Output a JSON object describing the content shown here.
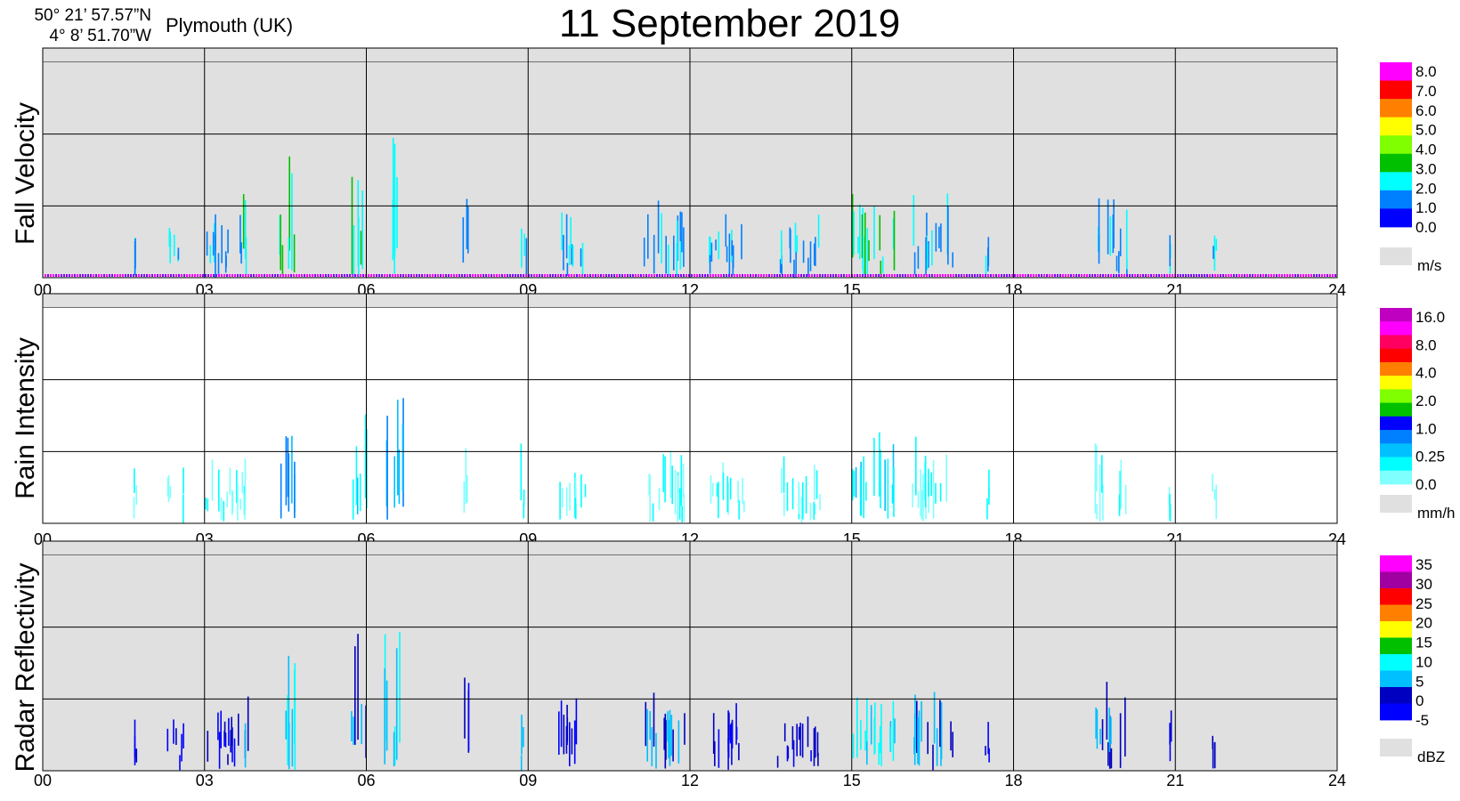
{
  "header": {
    "lat": "50° 21’ 57.57”N",
    "lon": "4°  8’ 51.70”W",
    "location": "Plymouth (UK)",
    "title": "11 September  2019"
  },
  "chart_data": [
    {
      "type": "heatmap",
      "ylabel": "Fall Velocity",
      "background": "#e0e0e0",
      "x_ticks": [
        "00",
        "03",
        "06",
        "09",
        "12",
        "15",
        "18",
        "21",
        "24"
      ],
      "xlim": [
        0,
        24
      ],
      "colorbar": {
        "labels": [
          "8.0",
          "7.0",
          "6.0",
          "5.0",
          "4.0",
          "3.0",
          "2.0",
          "1.0",
          "0.0"
        ],
        "colors": [
          "#ff00ff",
          "#ff0000",
          "#ff8000",
          "#ffff00",
          "#80ff00",
          "#00c000",
          "#00ffff",
          "#0080ff",
          "#0000ff"
        ],
        "nodata_color": "#e0e0e0",
        "unit": "m/s"
      },
      "events": [
        {
          "t": 1.7,
          "span": 0.05,
          "top": 0.25,
          "level": 1
        },
        {
          "t": 2.45,
          "span": 0.3,
          "top": 0.15,
          "level": 1
        },
        {
          "t": 3.35,
          "span": 0.7,
          "top": 0.2,
          "level": 1
        },
        {
          "t": 3.75,
          "span": 0.1,
          "top": 0.3,
          "level": 2
        },
        {
          "t": 4.55,
          "span": 0.35,
          "top": 0.5,
          "level": 2
        },
        {
          "t": 5.85,
          "span": 0.3,
          "top": 0.5,
          "level": 2
        },
        {
          "t": 6.5,
          "span": 0.35,
          "top": 0.53,
          "level": 2
        },
        {
          "t": 7.85,
          "span": 0.15,
          "top": 0.4,
          "level": 1
        },
        {
          "t": 8.9,
          "span": 0.12,
          "top": 0.28,
          "level": 1
        },
        {
          "t": 9.8,
          "span": 0.5,
          "top": 0.22,
          "level": 1
        },
        {
          "t": 11.5,
          "span": 0.8,
          "top": 0.26,
          "level": 1
        },
        {
          "t": 12.7,
          "span": 0.7,
          "top": 0.2,
          "level": 1
        },
        {
          "t": 14.0,
          "span": 0.8,
          "top": 0.18,
          "level": 1
        },
        {
          "t": 15.4,
          "span": 0.8,
          "top": 0.3,
          "level": 2
        },
        {
          "t": 16.5,
          "span": 0.8,
          "top": 0.28,
          "level": 1
        },
        {
          "t": 17.5,
          "span": 0.1,
          "top": 0.15,
          "level": 1
        },
        {
          "t": 19.8,
          "span": 0.6,
          "top": 0.28,
          "level": 1
        },
        {
          "t": 20.9,
          "span": 0.05,
          "top": 0.15,
          "level": 1
        },
        {
          "t": 21.7,
          "span": 0.1,
          "top": 0.18,
          "level": 1
        }
      ]
    },
    {
      "type": "heatmap",
      "ylabel": "Rain Intensity",
      "background": "#ffffff",
      "x_ticks": [
        "00",
        "03",
        "06",
        "09",
        "12",
        "15",
        "18",
        "21",
        "24"
      ],
      "xlim": [
        0,
        24
      ],
      "colorbar": {
        "labels": [
          "16.0",
          "8.0",
          "4.0",
          "2.0",
          "1.0",
          "0.25",
          "0.0"
        ],
        "colors": [
          "#c000c0",
          "#ff00ff",
          "#ff0060",
          "#ff0000",
          "#ff8000",
          "#ffff00",
          "#80ff00",
          "#00c000",
          "#0000ff",
          "#0080ff",
          "#00c0ff",
          "#00ffff",
          "#80ffff"
        ],
        "nodata_color": "#e0e0e0",
        "unit": "mm/h"
      },
      "events": [
        {
          "t": 1.7,
          "span": 0.05,
          "top": 0.25,
          "level": 0
        },
        {
          "t": 2.45,
          "span": 0.3,
          "top": 0.15,
          "level": 0
        },
        {
          "t": 3.35,
          "span": 0.7,
          "top": 0.2,
          "level": 0
        },
        {
          "t": 3.75,
          "span": 0.1,
          "top": 0.3,
          "level": 0
        },
        {
          "t": 4.55,
          "span": 0.35,
          "top": 0.5,
          "level": 2
        },
        {
          "t": 5.85,
          "span": 0.3,
          "top": 0.5,
          "level": 1
        },
        {
          "t": 6.5,
          "span": 0.35,
          "top": 0.53,
          "level": 2
        },
        {
          "t": 7.85,
          "span": 0.15,
          "top": 0.4,
          "level": 0
        },
        {
          "t": 8.9,
          "span": 0.12,
          "top": 0.28,
          "level": 0
        },
        {
          "t": 9.8,
          "span": 0.5,
          "top": 0.22,
          "level": 0
        },
        {
          "t": 11.5,
          "span": 0.8,
          "top": 0.26,
          "level": 0
        },
        {
          "t": 12.7,
          "span": 0.7,
          "top": 0.2,
          "level": 0
        },
        {
          "t": 14.0,
          "span": 0.8,
          "top": 0.18,
          "level": 0
        },
        {
          "t": 15.4,
          "span": 0.8,
          "top": 0.3,
          "level": 1
        },
        {
          "t": 16.5,
          "span": 0.8,
          "top": 0.28,
          "level": 0
        },
        {
          "t": 17.5,
          "span": 0.1,
          "top": 0.15,
          "level": 0
        },
        {
          "t": 19.8,
          "span": 0.6,
          "top": 0.28,
          "level": 0
        },
        {
          "t": 20.9,
          "span": 0.05,
          "top": 0.15,
          "level": 0
        },
        {
          "t": 21.7,
          "span": 0.1,
          "top": 0.18,
          "level": 0
        }
      ]
    },
    {
      "type": "heatmap",
      "ylabel": "Radar Reflectivity",
      "background": "#e0e0e0",
      "x_ticks": [
        "00",
        "03",
        "06",
        "09",
        "12",
        "15",
        "18",
        "21",
        "24"
      ],
      "xlim": [
        0,
        24
      ],
      "colorbar": {
        "labels": [
          "35",
          "30",
          "25",
          "20",
          "15",
          "10",
          "5",
          "0",
          "-5"
        ],
        "colors": [
          "#ff00ff",
          "#a000a0",
          "#ff0000",
          "#ff8000",
          "#ffff00",
          "#00c000",
          "#00ffff",
          "#00c0ff",
          "#0000c0",
          "#0000ff"
        ],
        "nodata_color": "#e0e0e0",
        "unit": "dBZ"
      },
      "events": [
        {
          "t": 1.7,
          "span": 0.05,
          "top": 0.25,
          "level": 0
        },
        {
          "t": 2.45,
          "span": 0.3,
          "top": 0.15,
          "level": 0
        },
        {
          "t": 3.35,
          "span": 0.7,
          "top": 0.2,
          "level": 0
        },
        {
          "t": 3.75,
          "span": 0.1,
          "top": 0.3,
          "level": 1
        },
        {
          "t": 4.55,
          "span": 0.35,
          "top": 0.5,
          "level": 2
        },
        {
          "t": 5.85,
          "span": 0.3,
          "top": 0.5,
          "level": 1
        },
        {
          "t": 6.5,
          "span": 0.35,
          "top": 0.53,
          "level": 2
        },
        {
          "t": 7.85,
          "span": 0.15,
          "top": 0.4,
          "level": 0
        },
        {
          "t": 8.9,
          "span": 0.12,
          "top": 0.28,
          "level": 1
        },
        {
          "t": 9.8,
          "span": 0.5,
          "top": 0.22,
          "level": 0
        },
        {
          "t": 11.5,
          "span": 0.8,
          "top": 0.26,
          "level": 1
        },
        {
          "t": 12.7,
          "span": 0.7,
          "top": 0.2,
          "level": 0
        },
        {
          "t": 14.0,
          "span": 0.8,
          "top": 0.18,
          "level": 0
        },
        {
          "t": 15.4,
          "span": 0.8,
          "top": 0.3,
          "level": 2
        },
        {
          "t": 16.5,
          "span": 0.8,
          "top": 0.28,
          "level": 1
        },
        {
          "t": 17.5,
          "span": 0.1,
          "top": 0.15,
          "level": 0
        },
        {
          "t": 19.8,
          "span": 0.6,
          "top": 0.28,
          "level": 1
        },
        {
          "t": 20.9,
          "span": 0.05,
          "top": 0.15,
          "level": 0
        },
        {
          "t": 21.7,
          "span": 0.1,
          "top": 0.18,
          "level": 0
        }
      ]
    }
  ]
}
